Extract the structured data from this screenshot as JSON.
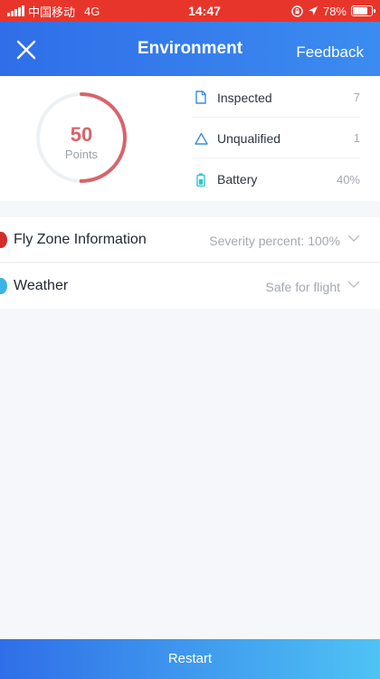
{
  "status_bar": {
    "carrier": "中国移动",
    "network": "4G",
    "time": "14:47",
    "battery": "78%",
    "battery_level": 0.78
  },
  "header": {
    "title": "Environment",
    "feedback_label": "Feedback",
    "close_icon": "close-icon"
  },
  "score": {
    "value": "50",
    "unit": "Points",
    "progress": 0.5,
    "ring_color": "#d9646a",
    "track_color": "#eef1f4"
  },
  "stats": [
    {
      "label": "Inspected",
      "value": "7",
      "icon": "document-icon"
    },
    {
      "label": "Unqualified",
      "value": "1",
      "icon": "warning-triangle-icon"
    },
    {
      "label": "Battery",
      "value": "40%",
      "icon": "battery-icon"
    }
  ],
  "info_rows": [
    {
      "label": "Fly Zone Information",
      "value": "Severity percent: 100%",
      "dot_color": "#d42b2b"
    },
    {
      "label": "Weather",
      "value": "Safe for flight",
      "dot_color": "#3ab3e8"
    }
  ],
  "footer": {
    "restart_label": "Restart"
  },
  "colors": {
    "accent": "#2f6ee8",
    "status_bar": "#e8352b",
    "icon_blue": "#3a8fdc"
  }
}
